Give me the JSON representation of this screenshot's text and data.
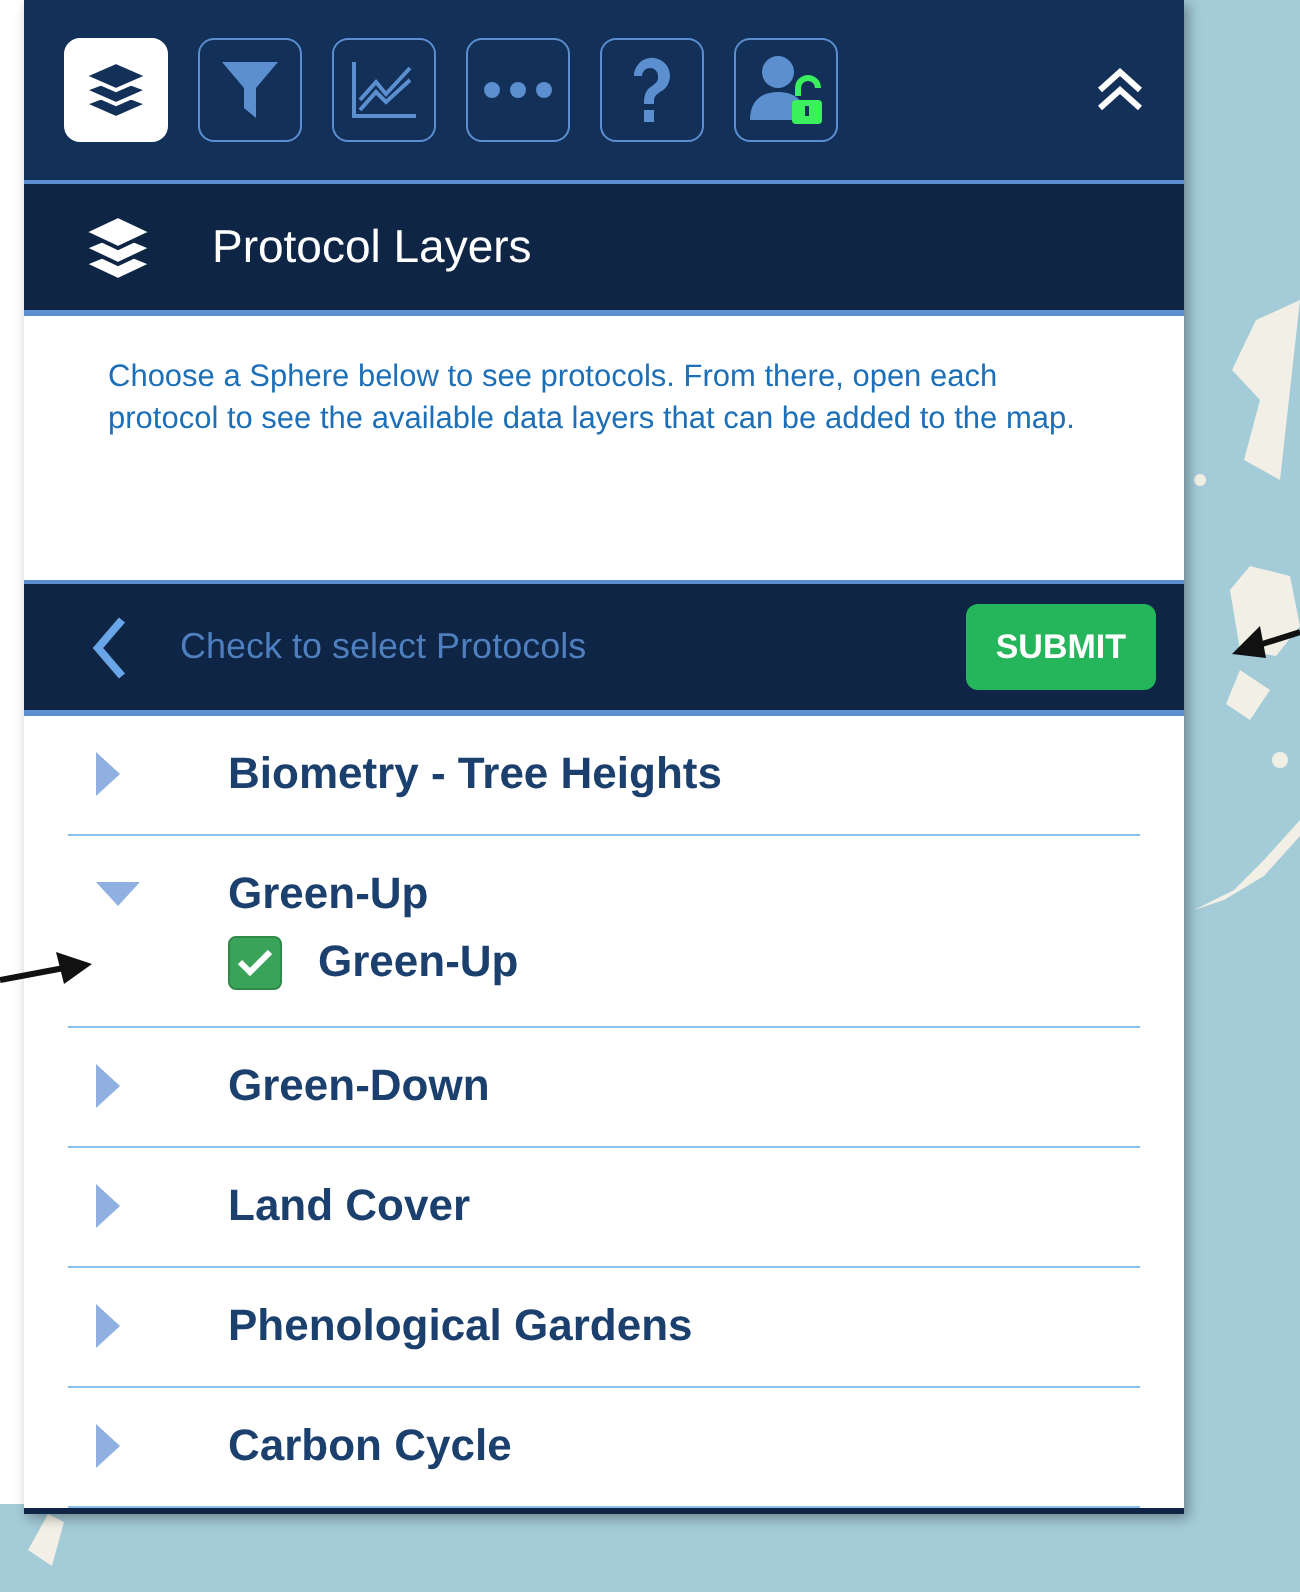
{
  "toolbar": {
    "buttons": [
      {
        "kind": "layers",
        "selected": true
      },
      {
        "kind": "filter",
        "selected": false
      },
      {
        "kind": "chart",
        "selected": false
      },
      {
        "kind": "more",
        "selected": false
      },
      {
        "kind": "help",
        "selected": false
      },
      {
        "kind": "user",
        "selected": false
      }
    ]
  },
  "header": {
    "title": "Protocol Layers"
  },
  "description": "Choose a Sphere below to see protocols. From there, open each protocol to see the available data layers that can be added to the map.",
  "subbar": {
    "hint": "Check to select Protocols",
    "submit": "SUBMIT"
  },
  "protocols": [
    {
      "label": "Biometry - Tree Heights",
      "expanded": false
    },
    {
      "label": "Green-Up",
      "expanded": true,
      "children": [
        {
          "label": "Green-Up",
          "checked": true
        }
      ]
    },
    {
      "label": "Green-Down",
      "expanded": false
    },
    {
      "label": "Land Cover",
      "expanded": false
    },
    {
      "label": "Phenological Gardens",
      "expanded": false
    },
    {
      "label": "Carbon Cycle",
      "expanded": false
    }
  ]
}
